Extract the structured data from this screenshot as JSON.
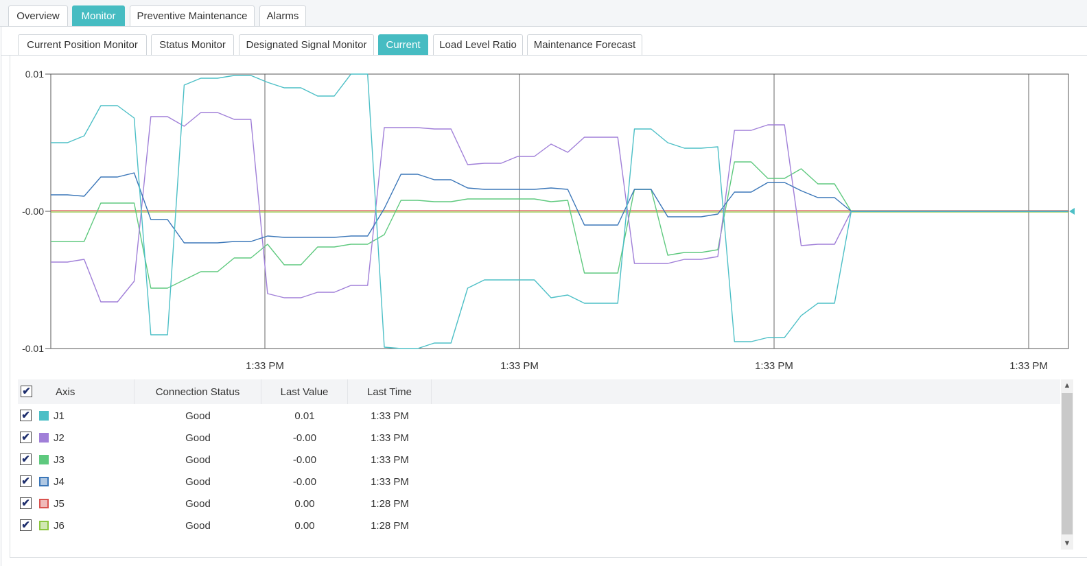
{
  "top_tabs": [
    {
      "label": "Overview",
      "active": false
    },
    {
      "label": "Monitor",
      "active": true
    },
    {
      "label": "Preventive Maintenance",
      "active": false
    },
    {
      "label": "Alarms",
      "active": false
    }
  ],
  "sub_tabs": [
    {
      "label": "Current Position Monitor",
      "active": false
    },
    {
      "label": "Status Monitor",
      "active": false
    },
    {
      "label": "Designated Signal Monitor",
      "active": false
    },
    {
      "label": "Current",
      "active": true
    },
    {
      "label": "Load Level Ratio",
      "active": false
    },
    {
      "label": "Maintenance Forecast",
      "active": false
    }
  ],
  "chart_data": {
    "type": "line",
    "title": "",
    "xlabel": "",
    "ylabel": "",
    "ylim": [
      -0.01,
      0.01
    ],
    "y_ticks": [
      "0.01",
      "-0.00",
      "-0.01"
    ],
    "x_ticks": [
      "1:33 PM",
      "1:33 PM",
      "1:33 PM",
      "1:33 PM"
    ],
    "grid": "vertical",
    "series": [
      {
        "name": "J1",
        "color": "#4cbfc6",
        "values": [
          0.005,
          0.005,
          0.0055,
          0.0077,
          0.0077,
          0.0068,
          -0.009,
          -0.009,
          0.0092,
          0.0097,
          0.0097,
          0.0099,
          0.0099,
          0.0094,
          0.009,
          0.009,
          0.0084,
          0.0084,
          0.0101,
          0.0101,
          -0.0099,
          -0.0101,
          -0.0101,
          -0.0096,
          -0.0096,
          -0.0056,
          -0.005,
          -0.005,
          -0.005,
          -0.005,
          -0.0063,
          -0.0061,
          -0.0067,
          -0.0067,
          -0.0067,
          0.006,
          0.006,
          0.005,
          0.0046,
          0.0046,
          0.0047,
          -0.0095,
          -0.0095,
          -0.0092,
          -0.0092,
          -0.0076,
          -0.0067,
          -0.0067,
          0.0,
          0.0,
          0.0,
          0.0,
          0.0,
          0.0,
          0.0,
          0.0,
          0.0,
          0.0,
          0.0,
          0.0,
          0.0,
          0.0
        ]
      },
      {
        "name": "J2",
        "color": "#a07fd8",
        "values": [
          -0.0037,
          -0.0037,
          -0.0035,
          -0.0066,
          -0.0066,
          -0.0051,
          0.0069,
          0.0069,
          0.0062,
          0.0072,
          0.0072,
          0.0067,
          0.0067,
          -0.006,
          -0.0063,
          -0.0063,
          -0.0059,
          -0.0059,
          -0.0054,
          -0.0054,
          0.0061,
          0.0061,
          0.0061,
          0.006,
          0.006,
          0.0034,
          0.0035,
          0.0035,
          0.004,
          0.004,
          0.0049,
          0.0043,
          0.0054,
          0.0054,
          0.0054,
          -0.0038,
          -0.0038,
          -0.0038,
          -0.0035,
          -0.0035,
          -0.0033,
          0.0059,
          0.0059,
          0.0063,
          0.0063,
          -0.0025,
          -0.0024,
          -0.0024,
          0.0,
          0.0,
          0.0,
          0.0,
          0.0,
          0.0,
          0.0,
          0.0,
          0.0,
          0.0,
          0.0,
          0.0,
          0.0,
          0.0
        ]
      },
      {
        "name": "J3",
        "color": "#5ec97e",
        "values": [
          -0.0022,
          -0.0022,
          -0.0022,
          0.0006,
          0.0006,
          0.0006,
          -0.0056,
          -0.0056,
          -0.005,
          -0.0044,
          -0.0044,
          -0.0034,
          -0.0034,
          -0.0024,
          -0.0039,
          -0.0039,
          -0.0026,
          -0.0026,
          -0.0024,
          -0.0024,
          -0.0017,
          0.0008,
          0.0008,
          0.0007,
          0.0007,
          0.0009,
          0.0009,
          0.0009,
          0.0009,
          0.0009,
          0.0007,
          0.0008,
          -0.0045,
          -0.0045,
          -0.0045,
          0.0016,
          0.0016,
          -0.0032,
          -0.003,
          -0.003,
          -0.0028,
          0.0036,
          0.0036,
          0.0024,
          0.0024,
          0.0031,
          0.002,
          0.002,
          0.0,
          0.0,
          0.0,
          0.0,
          0.0,
          0.0,
          0.0,
          0.0,
          0.0,
          0.0,
          0.0,
          0.0,
          0.0,
          0.0
        ]
      },
      {
        "name": "J4",
        "color": "#3a76b8",
        "values": [
          0.0012,
          0.0012,
          0.0011,
          0.0025,
          0.0025,
          0.0028,
          -0.0006,
          -0.0006,
          -0.0023,
          -0.0023,
          -0.0023,
          -0.0022,
          -0.0022,
          -0.0018,
          -0.0019,
          -0.0019,
          -0.0019,
          -0.0019,
          -0.0018,
          -0.0018,
          0.0002,
          0.0027,
          0.0027,
          0.0023,
          0.0023,
          0.0017,
          0.0016,
          0.0016,
          0.0016,
          0.0016,
          0.0017,
          0.0016,
          -0.001,
          -0.001,
          -0.001,
          0.0016,
          0.0016,
          -0.0004,
          -0.0004,
          -0.0004,
          -0.0002,
          0.0014,
          0.0014,
          0.0021,
          0.0021,
          0.0015,
          0.001,
          0.001,
          0.0,
          0.0,
          0.0,
          0.0,
          0.0,
          0.0,
          0.0,
          0.0,
          0.0,
          0.0,
          0.0,
          0.0,
          0.0,
          0.0
        ]
      },
      {
        "name": "J5",
        "color": "#d9534f",
        "values": [
          0.0,
          0.0
        ]
      },
      {
        "name": "J6",
        "color": "#8cc63f",
        "values": [
          0.0,
          0.0
        ]
      }
    ]
  },
  "table": {
    "columns": [
      "Axis",
      "Connection Status",
      "Last Value",
      "Last Time"
    ],
    "rows": [
      {
        "axis": "J1",
        "status": "Good",
        "value": "0.01",
        "time": "1:33 PM",
        "color": "#4cbfc6",
        "swatch": "solid"
      },
      {
        "axis": "J2",
        "status": "Good",
        "value": "-0.00",
        "time": "1:33 PM",
        "color": "#a07fd8",
        "swatch": "solid"
      },
      {
        "axis": "J3",
        "status": "Good",
        "value": "-0.00",
        "time": "1:33 PM",
        "color": "#5ec97e",
        "swatch": "solid"
      },
      {
        "axis": "J4",
        "status": "Good",
        "value": "-0.00",
        "time": "1:33 PM",
        "color": "#3a76b8",
        "swatch": "outline"
      },
      {
        "axis": "J5",
        "status": "Good",
        "value": "0.00",
        "time": "1:28 PM",
        "color": "#d9534f",
        "swatch": "outline"
      },
      {
        "axis": "J6",
        "status": "Good",
        "value": "0.00",
        "time": "1:28 PM",
        "color": "#8cc63f",
        "swatch": "outline"
      }
    ]
  },
  "checkbox_glyph": "✔"
}
